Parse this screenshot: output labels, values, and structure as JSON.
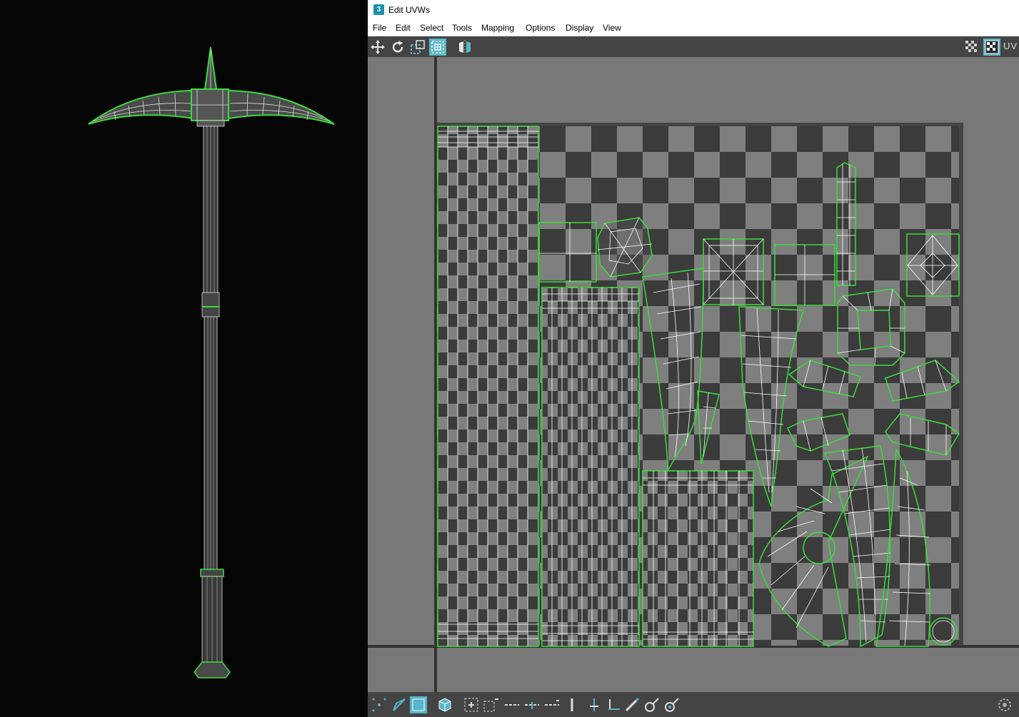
{
  "window": {
    "title": "Edit UVWs",
    "icon_label": "3"
  },
  "menu": [
    "File",
    "Edit",
    "Select",
    "Tools",
    "Mapping",
    "Options",
    "Display",
    "View"
  ],
  "toolbar": {
    "tools": [
      {
        "name": "move-icon"
      },
      {
        "name": "rotate-icon"
      },
      {
        "name": "scale-icon"
      },
      {
        "name": "freeform-icon",
        "active": true
      },
      {
        "name": "mirror-icon"
      }
    ],
    "right_label": "UV"
  },
  "bottom_toolbar": {
    "tools": [
      "vertex-select-icon",
      "edge-select-icon",
      "face-select-icon",
      "element-select-icon",
      "select-by-element-icon",
      "expand-selection-icon",
      "shrink-selection-icon",
      "loop-icon",
      "ring-icon",
      "grow-loop-icon",
      "align-vertical-icon",
      "align-horizontal-icon",
      "straighten-icon",
      "paint-select-icon",
      "sketch-icon",
      "relax-icon",
      "settings-icon"
    ]
  },
  "colors": {
    "accent": "#5ab5c7",
    "uv_shell_border": "#3cdc3c",
    "wire": "#ffffff",
    "checker_light": "#7f7f7f",
    "checker_dark": "#3b3b3b"
  }
}
